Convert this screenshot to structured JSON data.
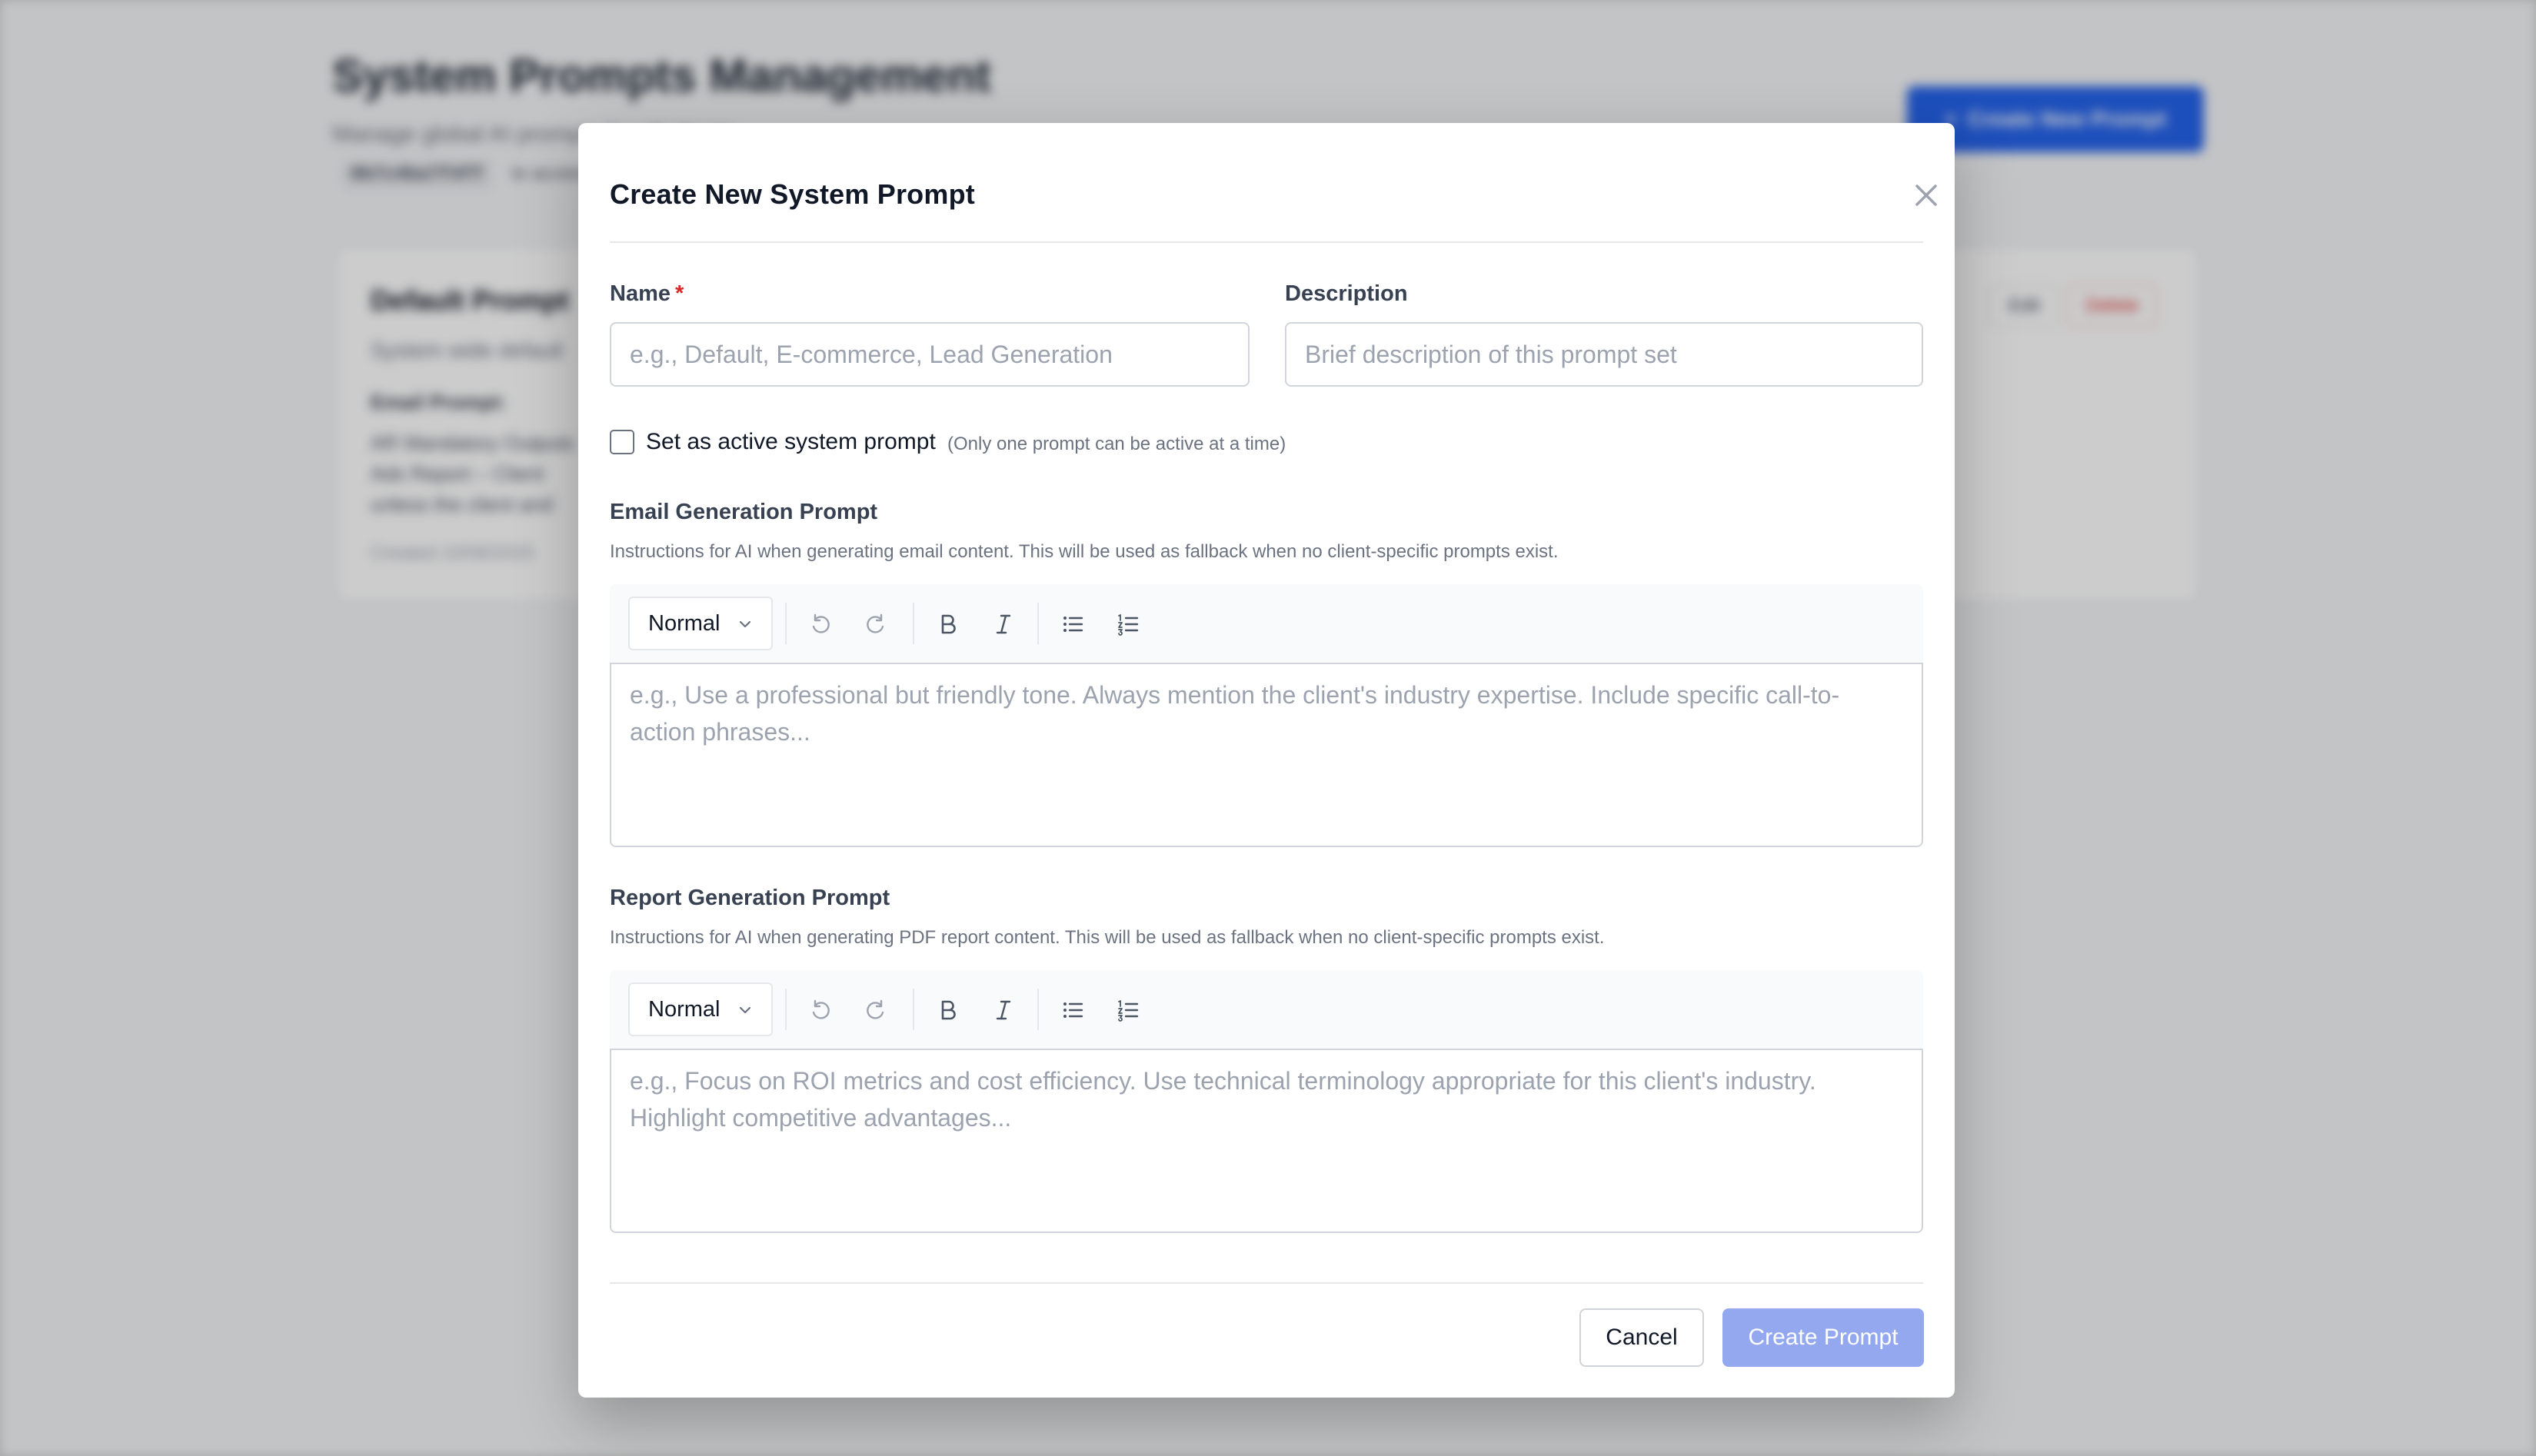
{
  "background": {
    "title": "System Prompts Management",
    "subtitle": "Manage global AI prompts for all clients",
    "user_code": "0b7c4ba7f4ff",
    "access_text": "to access",
    "create_button": "Create New Prompt",
    "card": {
      "title": "Default Prompt",
      "subtitle": "System wide default",
      "email_label": "Email Prompt:",
      "email_body": "AR Mandatory Outputs Ads Report – Client unless the client and",
      "created": "Created 10/08/2025",
      "edit_label": "Edit",
      "delete_label": "Delete"
    }
  },
  "modal": {
    "title": "Create New System Prompt",
    "name_label": "Name",
    "required_mark": "*",
    "name_placeholder": "e.g., Default, E-commerce, Lead Generation",
    "description_label": "Description",
    "description_placeholder": "Brief description of this prompt set",
    "active_label": "Set as active system prompt",
    "active_hint": "(Only one prompt can be active at a time)",
    "email_section": {
      "title": "Email Generation Prompt",
      "help": "Instructions for AI when generating email content. This will be used as fallback when no client-specific prompts exist.",
      "format_value": "Normal",
      "placeholder": "e.g., Use a professional but friendly tone. Always mention the client's industry expertise. Include specific call-to-action phrases..."
    },
    "report_section": {
      "title": "Report Generation Prompt",
      "help": "Instructions for AI when generating PDF report content. This will be used as fallback when no client-specific prompts exist.",
      "format_value": "Normal",
      "placeholder": "e.g., Focus on ROI metrics and cost efficiency. Use technical terminology appropriate for this client's industry. Highlight competitive advantages..."
    },
    "cancel_label": "Cancel",
    "create_label": "Create Prompt"
  },
  "colors": {
    "primary": "#2563eb",
    "primary_disabled": "#93a8ee",
    "danger": "#dc2626"
  },
  "icons": [
    "close-icon",
    "chevron-down-icon",
    "undo-icon",
    "redo-icon",
    "bold-icon",
    "italic-icon",
    "bullet-list-icon",
    "numbered-list-icon",
    "plus-icon"
  ]
}
